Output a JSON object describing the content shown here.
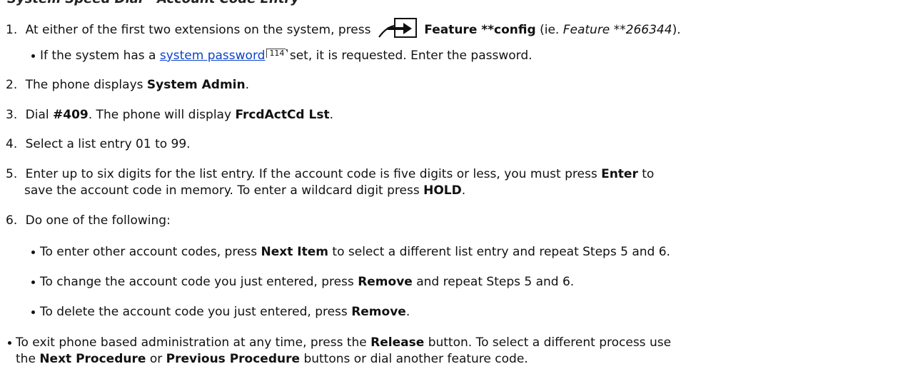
{
  "heading_partial": "System Speed Dial - Account Code Entry",
  "steps": {
    "s1": {
      "num": "1.",
      "a": "At either of the first two extensions on the system, press",
      "b": "Feature **config",
      "c": "(ie.",
      "d": "Feature **266344",
      "e": ")."
    },
    "s1_bullet": {
      "a": "If the system has a",
      "link": "system password",
      "page_ref": "114",
      "b": "set, it is requested. Enter the password."
    },
    "s2": {
      "num": "2.",
      "a": "The phone displays",
      "b": "System Admin",
      "c": "."
    },
    "s3": {
      "num": "3.",
      "a": "Dial",
      "b": "#409",
      "c": ". The phone will display",
      "d": "FrcdActCd Lst",
      "e": "."
    },
    "s4": {
      "num": "4.",
      "a": "Select a list entry 01 to 99."
    },
    "s5": {
      "num": "5.",
      "a": "Enter up to six digits for the list entry. If the account code is five digits or less, you must press",
      "b": "Enter",
      "c": "to",
      "line2_a": "save the account code in memory. To enter a wildcard digit press",
      "line2_b": "HOLD",
      "line2_c": "."
    },
    "s6": {
      "num": "6.",
      "a": "Do one of the following:"
    },
    "s6_b1": {
      "a": "To enter other account codes, press",
      "b": "Next Item",
      "c": "to select a different list entry and repeat Steps 5 and 6."
    },
    "s6_b2": {
      "a": "To change the account code you just entered, press",
      "b": "Remove",
      "c": "and repeat Steps 5 and 6."
    },
    "s6_b3": {
      "a": "To delete the account code you just entered, press",
      "b": "Remove",
      "c": "."
    }
  },
  "footer_bullet": {
    "a": "To exit phone based administration at any time, press the",
    "b": "Release",
    "c": "button. To select a different process use",
    "line2_a": "the",
    "line2_b": "Next Procedure",
    "line2_c": "or",
    "line2_d": "Previous Procedure",
    "line2_e": "buttons or dial another feature code."
  },
  "icons": {
    "feature_button": "feature-button-icon"
  }
}
